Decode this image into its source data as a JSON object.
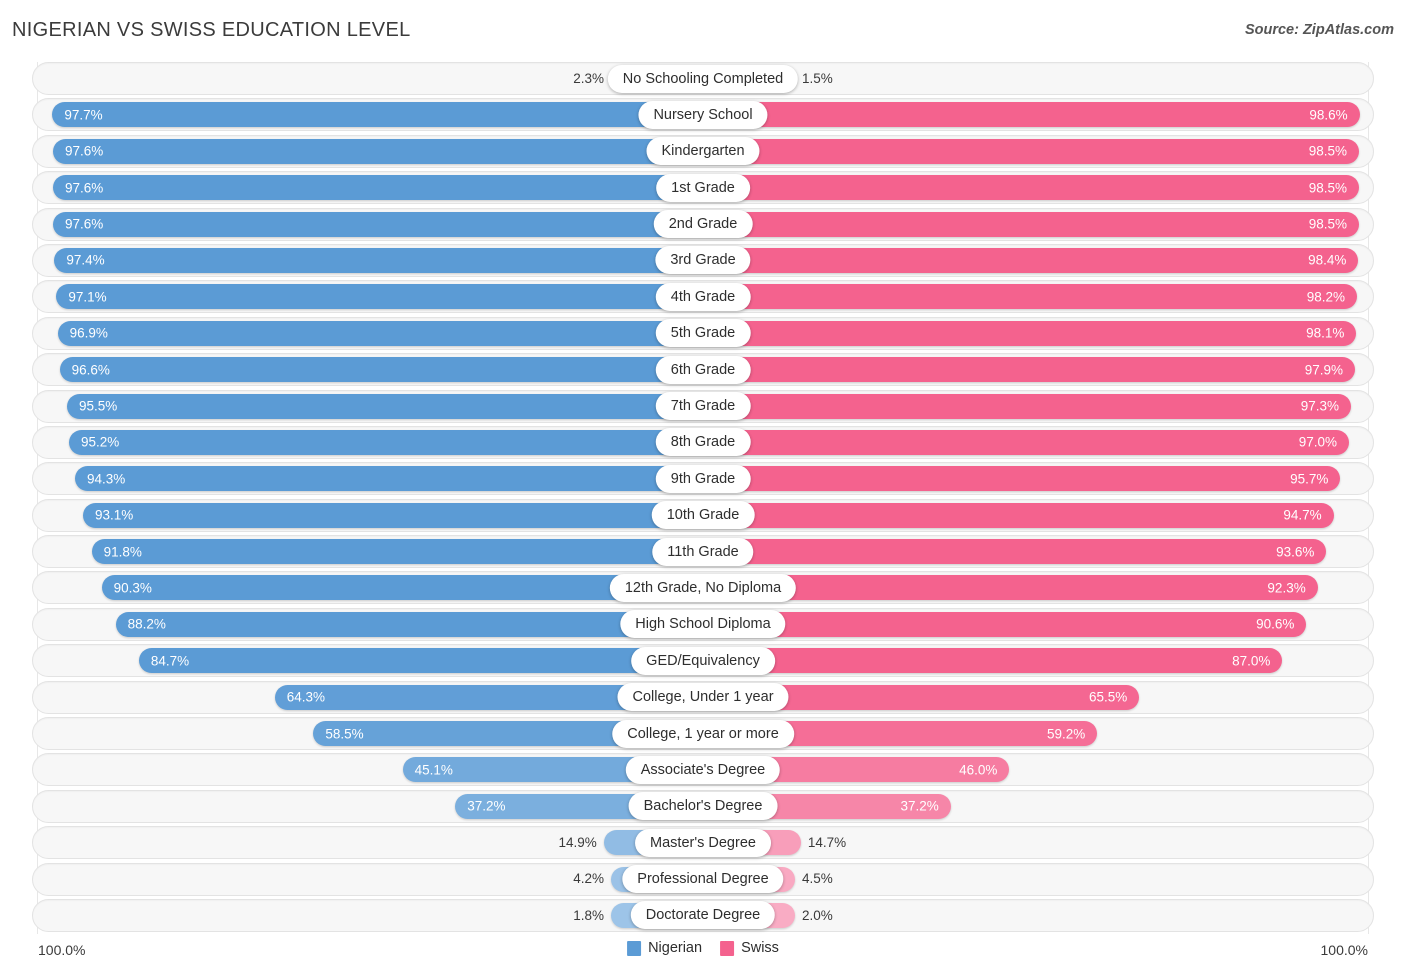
{
  "header": {
    "title": "NIGERIAN VS SWISS EDUCATION LEVEL",
    "source": "Source: ZipAtlas.com"
  },
  "footer": {
    "axis_left": "100.0%",
    "axis_right": "100.0%",
    "legend": [
      {
        "label": "Nigerian",
        "color": "#5b9bd5"
      },
      {
        "label": "Swiss",
        "color": "#f4628e"
      }
    ]
  },
  "colors": {
    "nigerian": "#5b9bd5",
    "swiss": "#f4628e",
    "nigerian_light": "#9fc5e8",
    "swiss_light": "#f9aec6",
    "track": "#f7f7f7",
    "track_border": "#e3e3e3",
    "gridline": "#e7e7e7"
  },
  "chart_data": {
    "type": "bar",
    "orientation": "horizontal-diverging",
    "title": "NIGERIAN VS SWISS EDUCATION LEVEL",
    "xlabel": "",
    "ylabel": "",
    "xlim": [
      0,
      100
    ],
    "grid": false,
    "legend_position": "bottom-center",
    "series": [
      {
        "name": "Nigerian",
        "color": "#5b9bd5",
        "side": "left"
      },
      {
        "name": "Swiss",
        "color": "#f4628e",
        "side": "right"
      }
    ],
    "categories": [
      "No Schooling Completed",
      "Nursery School",
      "Kindergarten",
      "1st Grade",
      "2nd Grade",
      "3rd Grade",
      "4th Grade",
      "5th Grade",
      "6th Grade",
      "7th Grade",
      "8th Grade",
      "9th Grade",
      "10th Grade",
      "11th Grade",
      "12th Grade, No Diploma",
      "High School Diploma",
      "GED/Equivalency",
      "College, Under 1 year",
      "College, 1 year or more",
      "Associate's Degree",
      "Bachelor's Degree",
      "Master's Degree",
      "Professional Degree",
      "Doctorate Degree"
    ],
    "nigerian_values": [
      2.3,
      97.7,
      97.6,
      97.6,
      97.6,
      97.4,
      97.1,
      96.9,
      96.6,
      95.5,
      95.2,
      94.3,
      93.1,
      91.8,
      90.3,
      88.2,
      84.7,
      64.3,
      58.5,
      45.1,
      37.2,
      14.9,
      4.2,
      1.8
    ],
    "swiss_values": [
      1.5,
      98.6,
      98.5,
      98.5,
      98.5,
      98.4,
      98.2,
      98.1,
      97.9,
      97.3,
      97.0,
      95.7,
      94.7,
      93.6,
      92.3,
      90.6,
      87.0,
      65.5,
      59.2,
      46.0,
      37.2,
      14.7,
      4.5,
      2.0
    ]
  },
  "rows": [
    {
      "label": "No Schooling Completed",
      "left": "2.3%",
      "right": "1.5%",
      "lv": 2.3,
      "rv": 1.5
    },
    {
      "label": "Nursery School",
      "left": "97.7%",
      "right": "98.6%",
      "lv": 97.7,
      "rv": 98.6
    },
    {
      "label": "Kindergarten",
      "left": "97.6%",
      "right": "98.5%",
      "lv": 97.6,
      "rv": 98.5
    },
    {
      "label": "1st Grade",
      "left": "97.6%",
      "right": "98.5%",
      "lv": 97.6,
      "rv": 98.5
    },
    {
      "label": "2nd Grade",
      "left": "97.6%",
      "right": "98.5%",
      "lv": 97.6,
      "rv": 98.5
    },
    {
      "label": "3rd Grade",
      "left": "97.4%",
      "right": "98.4%",
      "lv": 97.4,
      "rv": 98.4
    },
    {
      "label": "4th Grade",
      "left": "97.1%",
      "right": "98.2%",
      "lv": 97.1,
      "rv": 98.2
    },
    {
      "label": "5th Grade",
      "left": "96.9%",
      "right": "98.1%",
      "lv": 96.9,
      "rv": 98.1
    },
    {
      "label": "6th Grade",
      "left": "96.6%",
      "right": "97.9%",
      "lv": 96.6,
      "rv": 97.9
    },
    {
      "label": "7th Grade",
      "left": "95.5%",
      "right": "97.3%",
      "lv": 95.5,
      "rv": 97.3
    },
    {
      "label": "8th Grade",
      "left": "95.2%",
      "right": "97.0%",
      "lv": 95.2,
      "rv": 97.0
    },
    {
      "label": "9th Grade",
      "left": "94.3%",
      "right": "95.7%",
      "lv": 94.3,
      "rv": 95.7
    },
    {
      "label": "10th Grade",
      "left": "93.1%",
      "right": "94.7%",
      "lv": 93.1,
      "rv": 94.7
    },
    {
      "label": "11th Grade",
      "left": "91.8%",
      "right": "93.6%",
      "lv": 91.8,
      "rv": 93.6
    },
    {
      "label": "12th Grade, No Diploma",
      "left": "90.3%",
      "right": "92.3%",
      "lv": 90.3,
      "rv": 92.3
    },
    {
      "label": "High School Diploma",
      "left": "88.2%",
      "right": "90.6%",
      "lv": 88.2,
      "rv": 90.6
    },
    {
      "label": "GED/Equivalency",
      "left": "84.7%",
      "right": "87.0%",
      "lv": 84.7,
      "rv": 87.0
    },
    {
      "label": "College, Under 1 year",
      "left": "64.3%",
      "right": "65.5%",
      "lv": 64.3,
      "rv": 65.5
    },
    {
      "label": "College, 1 year or more",
      "left": "58.5%",
      "right": "59.2%",
      "lv": 58.5,
      "rv": 59.2
    },
    {
      "label": "Associate's Degree",
      "left": "45.1%",
      "right": "46.0%",
      "lv": 45.1,
      "rv": 46.0
    },
    {
      "label": "Bachelor's Degree",
      "left": "37.2%",
      "right": "37.2%",
      "lv": 37.2,
      "rv": 37.2
    },
    {
      "label": "Master's Degree",
      "left": "14.9%",
      "right": "14.7%",
      "lv": 14.9,
      "rv": 14.7
    },
    {
      "label": "Professional Degree",
      "left": "4.2%",
      "right": "4.5%",
      "lv": 4.2,
      "rv": 4.5
    },
    {
      "label": "Doctorate Degree",
      "left": "1.8%",
      "right": "2.0%",
      "lv": 1.8,
      "rv": 2.0
    }
  ]
}
